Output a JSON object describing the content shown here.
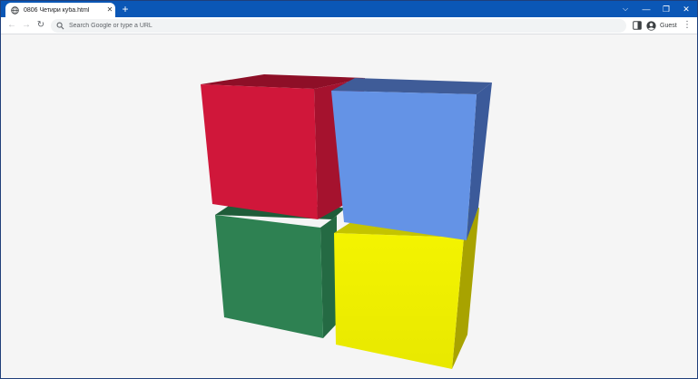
{
  "browser": {
    "tab": {
      "title": "0806 Четири куба.html",
      "favicon": "globe-icon",
      "close": "✕"
    },
    "new_tab": "+",
    "window_controls": {
      "list": "⌵",
      "minimize": "—",
      "maximize": "❐",
      "close": "✕"
    },
    "toolbar": {
      "back": "←",
      "forward": "→",
      "reload": "↻",
      "omnibox_placeholder": "Search Google or type a URL",
      "profile_name": "Guest",
      "menu": "⋮"
    },
    "colors": {
      "tabstrip": "#0b57b6",
      "page_background": "#f5f5f5"
    }
  },
  "scene": {
    "cubes": [
      {
        "name": "red",
        "front": "#d0173a",
        "top": "#8e0f27",
        "side": "#a5122e"
      },
      {
        "name": "blue",
        "front": "#6493e6",
        "top": "#3f5c98",
        "side": "#3b5a9a"
      },
      {
        "name": "green",
        "front": "#2e8152",
        "top": "#1f5c39",
        "side": "#246a43"
      },
      {
        "name": "yellow",
        "front": "#f2f200",
        "top": "#c4c400",
        "side": "#a8a300"
      }
    ]
  }
}
